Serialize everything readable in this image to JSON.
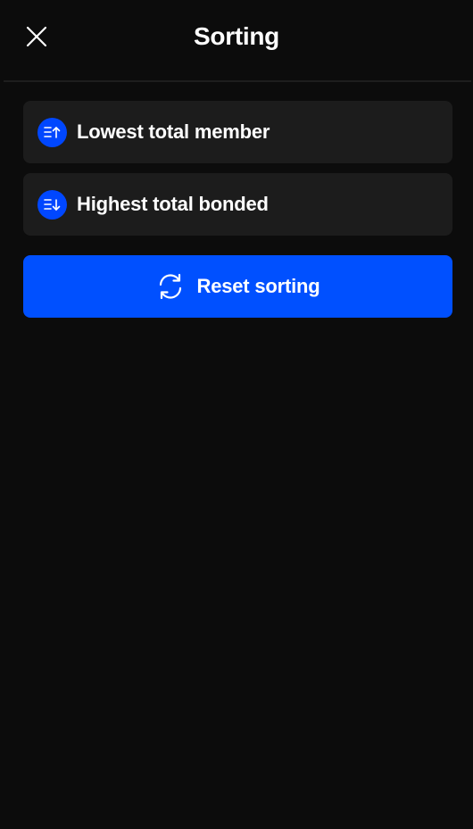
{
  "header": {
    "title": "Sorting",
    "close_icon": "close-icon"
  },
  "options": [
    {
      "label": "Lowest total member",
      "icon": "sort-ascending-icon"
    },
    {
      "label": "Highest total bonded",
      "icon": "sort-descending-icon"
    }
  ],
  "reset": {
    "label": "Reset sorting",
    "icon": "refresh-icon"
  },
  "colors": {
    "background": "#0c0c0c",
    "card": "#1c1c1c",
    "accent": "#0050ff",
    "icon_circle": "#0047ff",
    "text": "#ffffff"
  }
}
